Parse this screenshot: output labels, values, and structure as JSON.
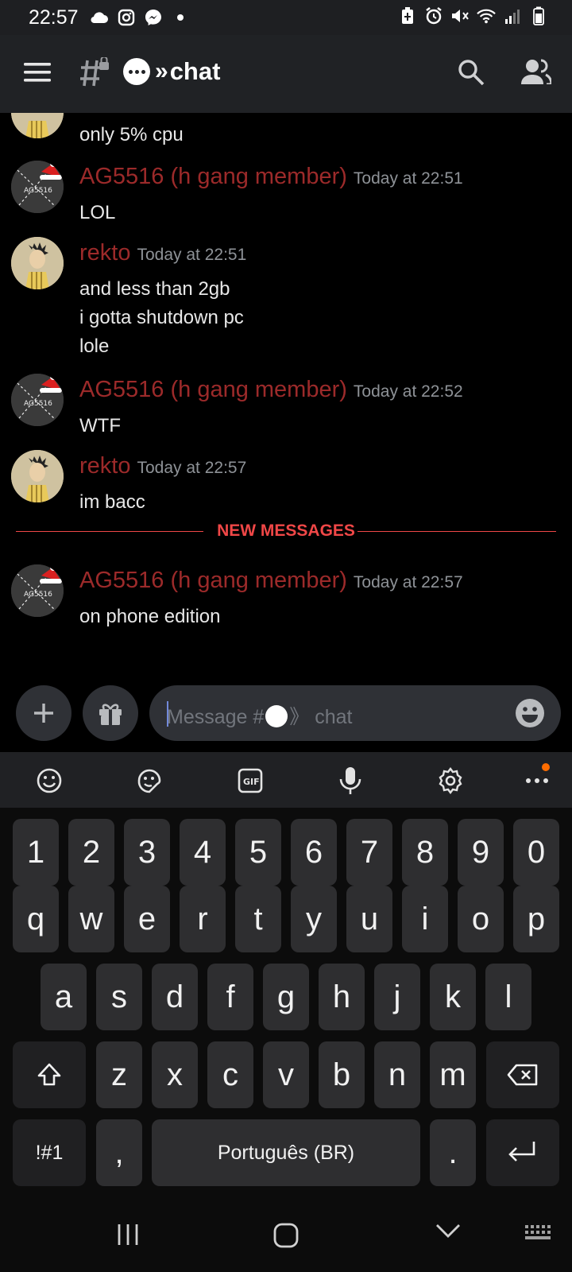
{
  "status_bar": {
    "time": "22:57",
    "left_icons": [
      "cloud-icon",
      "instagram-icon",
      "messenger-icon",
      "dot-icon"
    ],
    "right_icons": [
      "battery-saver-icon",
      "alarm-icon",
      "mute-icon",
      "wifi-icon",
      "signal-icon",
      "battery-icon"
    ]
  },
  "header": {
    "channel_name": "chat",
    "channel_arrows": "»",
    "menu_icon": "menu-icon",
    "channel_type_icon": "hash-lock-icon",
    "search_icon": "search-icon",
    "members_icon": "members-icon"
  },
  "messages": [
    {
      "author": "",
      "time": "",
      "lines": [
        "only 5% cpu"
      ],
      "avatar": "rekto"
    },
    {
      "author": "AG5516 (h gang member)",
      "time": "Today at 22:51",
      "lines": [
        "LOL"
      ],
      "avatar": "ag"
    },
    {
      "author": "rekto",
      "time": "Today at 22:51",
      "lines": [
        "and less than 2gb",
        "i gotta shutdown pc",
        "lole"
      ],
      "avatar": "rekto"
    },
    {
      "author": "AG5516 (h gang member)",
      "time": "Today at 22:52",
      "lines": [
        "WTF"
      ],
      "avatar": "ag"
    },
    {
      "author": "rekto",
      "time": "Today at 22:57",
      "lines": [
        "im bacc"
      ],
      "avatar": "rekto"
    },
    {
      "author": "AG5516 (h gang member)",
      "time": "Today at 22:57",
      "lines": [
        "on phone edition"
      ],
      "avatar": "ag"
    }
  ],
  "new_messages_label": "NEW MESSAGES",
  "avatar_ag_text": "AG5516",
  "composer": {
    "placeholder_prefix": "Message #",
    "placeholder_suffix": "》 chat"
  },
  "keyboard": {
    "toolbar_icons": [
      "emoji-icon",
      "sticker-icon",
      "gif-icon",
      "microphone-icon",
      "settings-icon",
      "more-icon"
    ],
    "gif_label": "GIF",
    "row1": [
      "1",
      "2",
      "3",
      "4",
      "5",
      "6",
      "7",
      "8",
      "9",
      "0"
    ],
    "row2": [
      "q",
      "w",
      "e",
      "r",
      "t",
      "y",
      "u",
      "i",
      "o",
      "p"
    ],
    "row3": [
      "a",
      "s",
      "d",
      "f",
      "g",
      "h",
      "j",
      "k",
      "l"
    ],
    "row4": [
      "z",
      "x",
      "c",
      "v",
      "b",
      "n",
      "m"
    ],
    "symbols_label": "!#1",
    "comma_label": ",",
    "space_label": "Português (BR)",
    "period_label": "."
  },
  "colors": {
    "username": "#9c2a2a",
    "new_messages": "#f04747",
    "timestamp": "#8e9297",
    "header_bg": "#202225"
  }
}
